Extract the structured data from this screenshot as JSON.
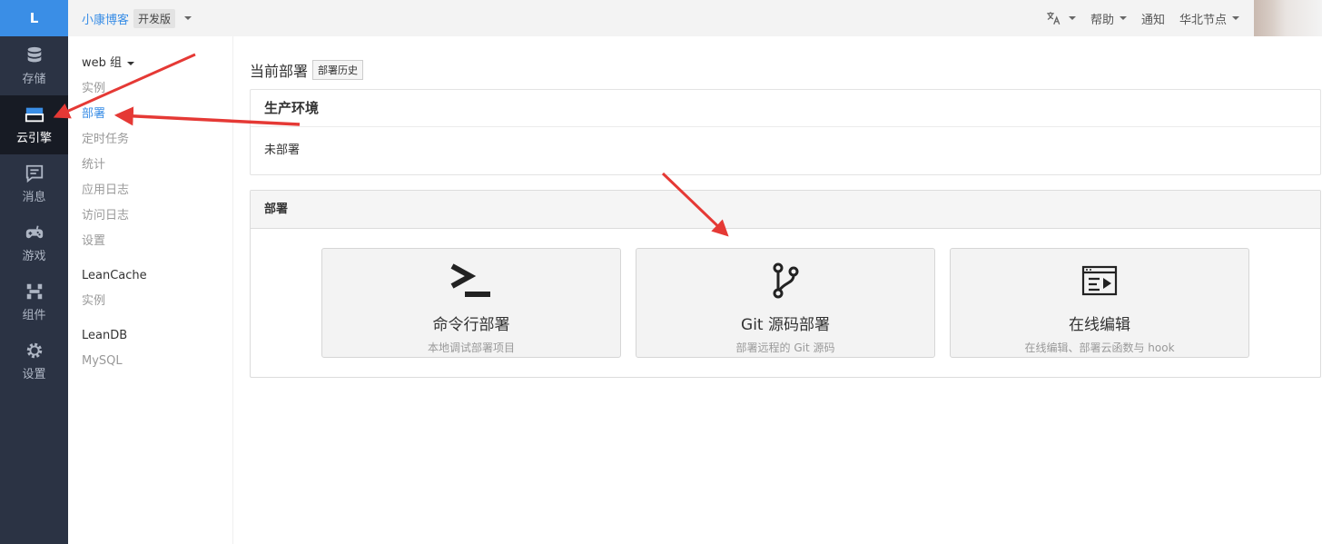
{
  "rail": {
    "logo": "L",
    "items": [
      {
        "label": "存储",
        "icon": "database-icon"
      },
      {
        "label": "云引擎",
        "icon": "cloud-engine-icon",
        "active": true
      },
      {
        "label": "消息",
        "icon": "message-icon"
      },
      {
        "label": "游戏",
        "icon": "gamepad-icon"
      },
      {
        "label": "组件",
        "icon": "component-icon"
      },
      {
        "label": "设置",
        "icon": "gear-icon"
      }
    ]
  },
  "topbar": {
    "app_name": "小康博客",
    "edition": "开发版",
    "right": {
      "lang_icon": "translate-icon",
      "help": "帮助",
      "notify": "通知",
      "region": "华北节点"
    }
  },
  "subnav": {
    "web_group": "web 组",
    "web_links": [
      "实例",
      "部署",
      "定时任务",
      "统计",
      "应用日志",
      "访问日志",
      "设置"
    ],
    "leancache": "LeanCache",
    "leancache_links": [
      "实例"
    ],
    "leandb": "LeanDB",
    "leandb_links": [
      "MySQL"
    ]
  },
  "main": {
    "current_title": "当前部署",
    "history_button": "部署历史",
    "env_title": "生产环境",
    "env_status": "未部署",
    "deploy_title": "部署",
    "cards": [
      {
        "title": "命令行部署",
        "desc": "本地调试部署项目",
        "icon": "terminal-icon"
      },
      {
        "title": "Git 源码部署",
        "desc": "部署远程的 Git 源码",
        "icon": "git-branch-icon"
      },
      {
        "title": "在线编辑",
        "desc": "在线编辑、部署云函数与 hook",
        "icon": "online-editor-icon"
      }
    ]
  },
  "colors": {
    "rail_bg": "#2b3344",
    "accent": "#3a8ee6",
    "arrow": "#e53935"
  }
}
